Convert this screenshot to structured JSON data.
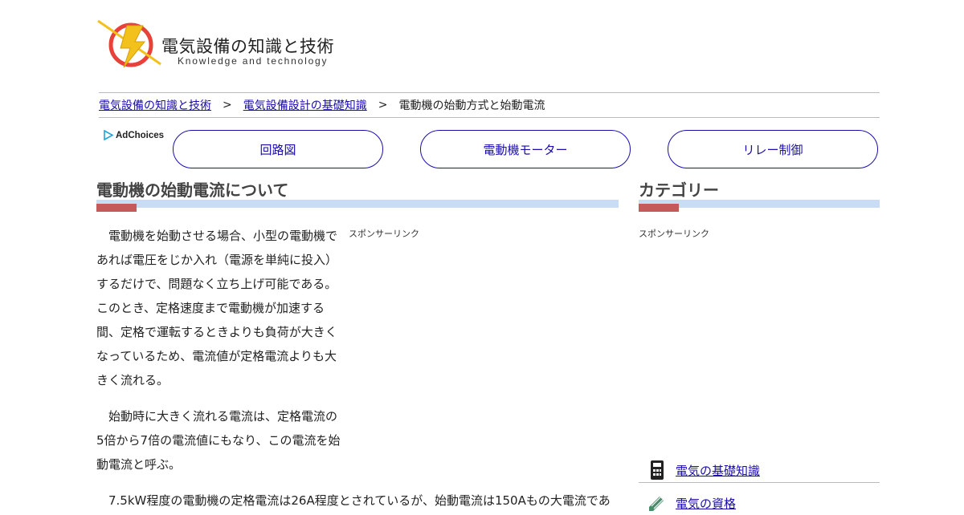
{
  "logo": {
    "title": "電気設備の知識と技術",
    "subtitle": "Knowledge and technology"
  },
  "breadcrumb": {
    "items": [
      "電気設備の知識と技術",
      "電気設備設計の基礎知識",
      "電動機の始動方式と始動電流"
    ],
    "separator": ">"
  },
  "ad": {
    "label": "AdChoices"
  },
  "nav": {
    "buttons": [
      "回路図",
      "電動機モーター",
      "リレー制御"
    ]
  },
  "main": {
    "heading": "電動機の始動電流について",
    "sponsor_label": "スポンサーリンク",
    "paragraphs": [
      "　電動機を始動させる場合、小型の電動機であれば電圧をじか入れ（電源を単純に投入）するだけで、問題なく立ち上げ可能である。このとき、定格速度まで電動機が加速する間、定格で運転するときよりも負荷が大きくなっているため、電流値が定格電流よりも大きく流れる。",
      "　始動時に大きく流れる電流は、定格電流の5倍から7倍の電流値にもなり、この電流を始動電流と呼ぶ。",
      "　7.5kW程度の電動機の定格電流は26A程度とされているが、始動電流は150Aもの大電流であ"
    ]
  },
  "sidebar": {
    "heading": "カテゴリー",
    "sponsor_label": "スポンサーリンク",
    "categories": [
      {
        "label": "電気の基礎知識",
        "icon": "calculator-icon"
      },
      {
        "label": "電気の資格",
        "icon": "pencil-icon"
      }
    ]
  },
  "colors": {
    "link": "#1a0dab",
    "heading_bar": "#c8dcf5",
    "heading_accent": "#c55a5a",
    "logo_red": "#e8413a",
    "logo_yellow": "#f3c11b"
  }
}
